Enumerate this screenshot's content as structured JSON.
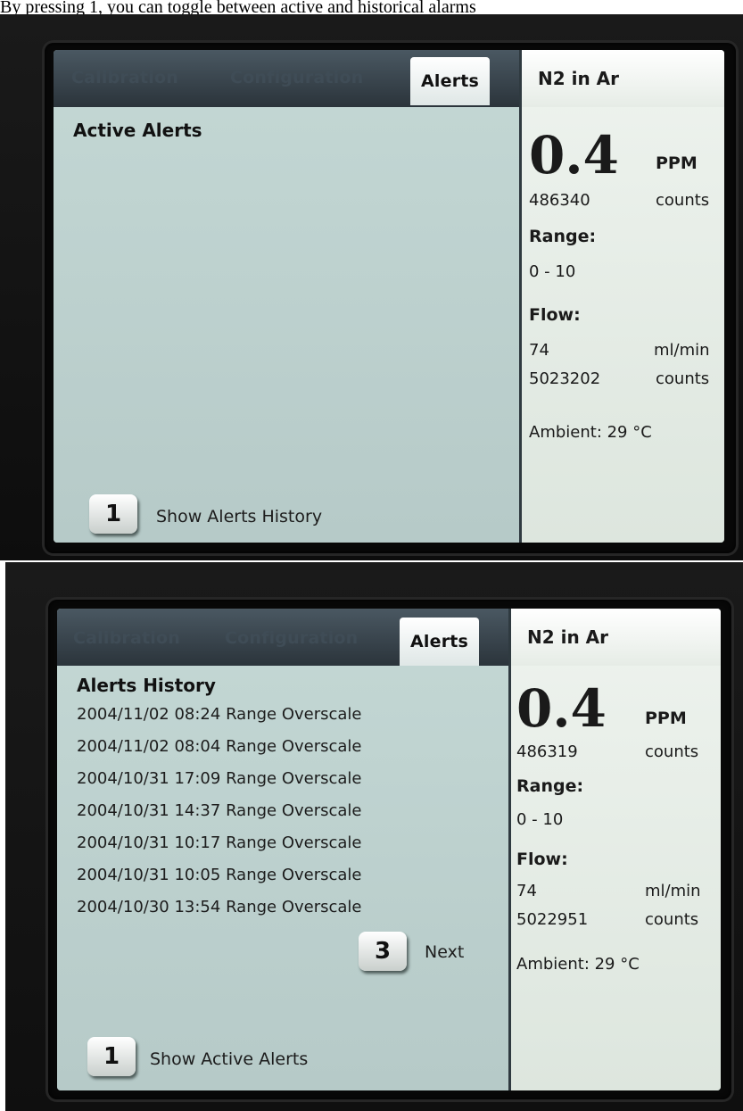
{
  "caption": "By pressing 1, you can toggle between active and historical alarms",
  "screen1": {
    "tabs": [
      "Calibration",
      "Configuration",
      "Alerts"
    ],
    "gas_label": "N2 in Ar",
    "heading": "Active Alerts",
    "reading": "0.4",
    "unit": "PPM",
    "reading_counts": "486340",
    "counts_label": "counts",
    "range_label": "Range:",
    "range_value": "0 - 10",
    "flow_label": "Flow:",
    "flow_value": "74",
    "flow_unit": "ml/min",
    "flow_counts": "5023202",
    "ambient": "Ambient: 29 °C",
    "key_number": "1",
    "key_label": "Show Alerts History"
  },
  "screen2": {
    "tabs": [
      "Calibration",
      "Configuration",
      "Alerts"
    ],
    "gas_label": "N2 in Ar",
    "heading": "Alerts History",
    "history": [
      "2004/11/02 08:24 Range Overscale",
      "2004/11/02 08:04 Range Overscale",
      "2004/10/31 17:09 Range Overscale",
      "2004/10/31 14:37 Range Overscale",
      "2004/10/31 10:17 Range Overscale",
      "2004/10/31 10:05 Range Overscale",
      "2004/10/30 13:54 Range Overscale"
    ],
    "next_key": "3",
    "next_label": "Next",
    "reading": "0.4",
    "unit": "PPM",
    "reading_counts": "486319",
    "counts_label": "counts",
    "range_label": "Range:",
    "range_value": "0 - 10",
    "flow_label": "Flow:",
    "flow_value": "74",
    "flow_unit": "ml/min",
    "flow_counts": "5022951",
    "ambient": "Ambient: 29 °C",
    "key_number": "1",
    "key_label": "Show Active Alerts"
  }
}
